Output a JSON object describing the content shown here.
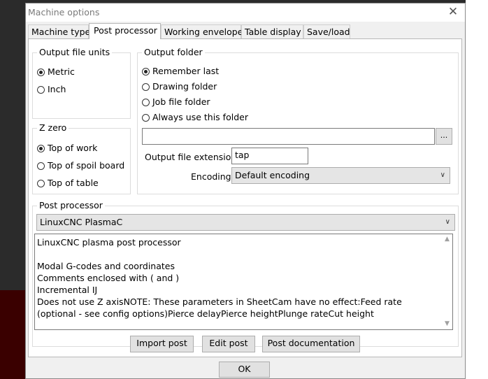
{
  "window": {
    "title": "Machine options"
  },
  "tabs": [
    "Machine type",
    "Post processor",
    "Working envelope",
    "Table display",
    "Save/load"
  ],
  "units": {
    "label": "Output file units",
    "options": [
      "Metric",
      "Inch"
    ],
    "selected": "Metric"
  },
  "zzero": {
    "label": "Z zero",
    "options": [
      "Top of work",
      "Top of spoil board",
      "Top of table"
    ],
    "selected": "Top of work"
  },
  "folder": {
    "label": "Output folder",
    "options": [
      "Remember last",
      "Drawing folder",
      "Job file folder",
      "Always use this folder"
    ],
    "selected": "Remember last",
    "path_value": "",
    "browse_label": "...",
    "extension_label": "Output file extension",
    "extension_value": "tap",
    "encoding_label": "Encoding",
    "encoding_value": "Default encoding"
  },
  "post": {
    "label": "Post processor",
    "selected": "LinuxCNC PlasmaC",
    "description_lines": [
      "LinuxCNC plasma post processor",
      "",
      "Modal G-codes and coordinates",
      "Comments enclosed with ( and )",
      "Incremental IJ",
      "Does not use Z axisNOTE: These parameters in SheetCam have no effect:Feed rate (optional - see config options)Pierce delayPierce heightPlunge rateCut height"
    ],
    "buttons": {
      "import": "Import post",
      "edit": "Edit post",
      "documentation": "Post documentation"
    }
  },
  "footer": {
    "ok": "OK"
  },
  "icons": {
    "close": "close-icon",
    "dropdown": "chevron-down-icon",
    "scroll_up": "scroll-up-icon",
    "scroll_down": "scroll-down-icon"
  }
}
